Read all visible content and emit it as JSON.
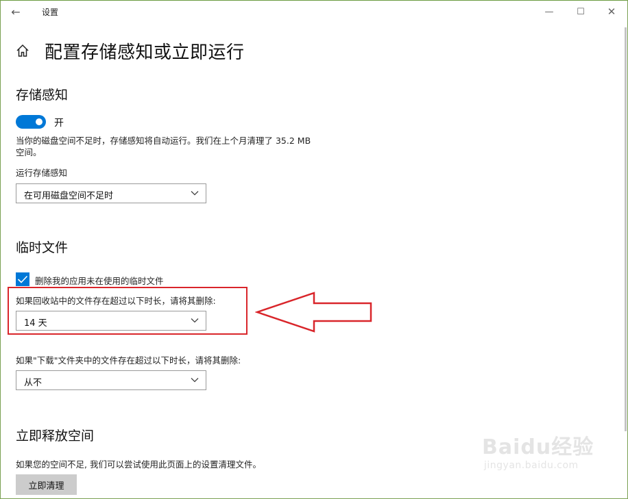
{
  "window": {
    "title": "设置",
    "minimize": "—",
    "maximize": "☐",
    "close": "✕",
    "back": "←"
  },
  "header": {
    "title": "配置存储感知或立即运行"
  },
  "storage_sense": {
    "title": "存储感知",
    "toggle_state": "开",
    "toggle_on": true,
    "description": "当你的磁盘空间不足时，存储感知将自动运行。我们在上个月清理了 35.2 MB 空间。",
    "run_label": "运行存储感知",
    "run_value": "在可用磁盘空间不足时"
  },
  "temp_files": {
    "title": "临时文件",
    "checkbox_label": "删除我的应用未在使用的临时文件",
    "checkbox_checked": true,
    "recycle_label": "如果回收站中的文件存在超过以下时长，请将其删除:",
    "recycle_value": "14 天",
    "downloads_label": "如果\"下载\"文件夹中的文件存在超过以下时长，请将其删除:",
    "downloads_value": "从不"
  },
  "free_space": {
    "title": "立即释放空间",
    "description": "如果您的空间不足, 我们可以尝试使用此页面上的设置清理文件。",
    "button": "立即清理"
  },
  "watermark": {
    "logo": "Baidu经验",
    "sub": "jingyan.baidu.com"
  },
  "colors": {
    "accent": "#0078d7",
    "annotation": "#d9252a"
  }
}
